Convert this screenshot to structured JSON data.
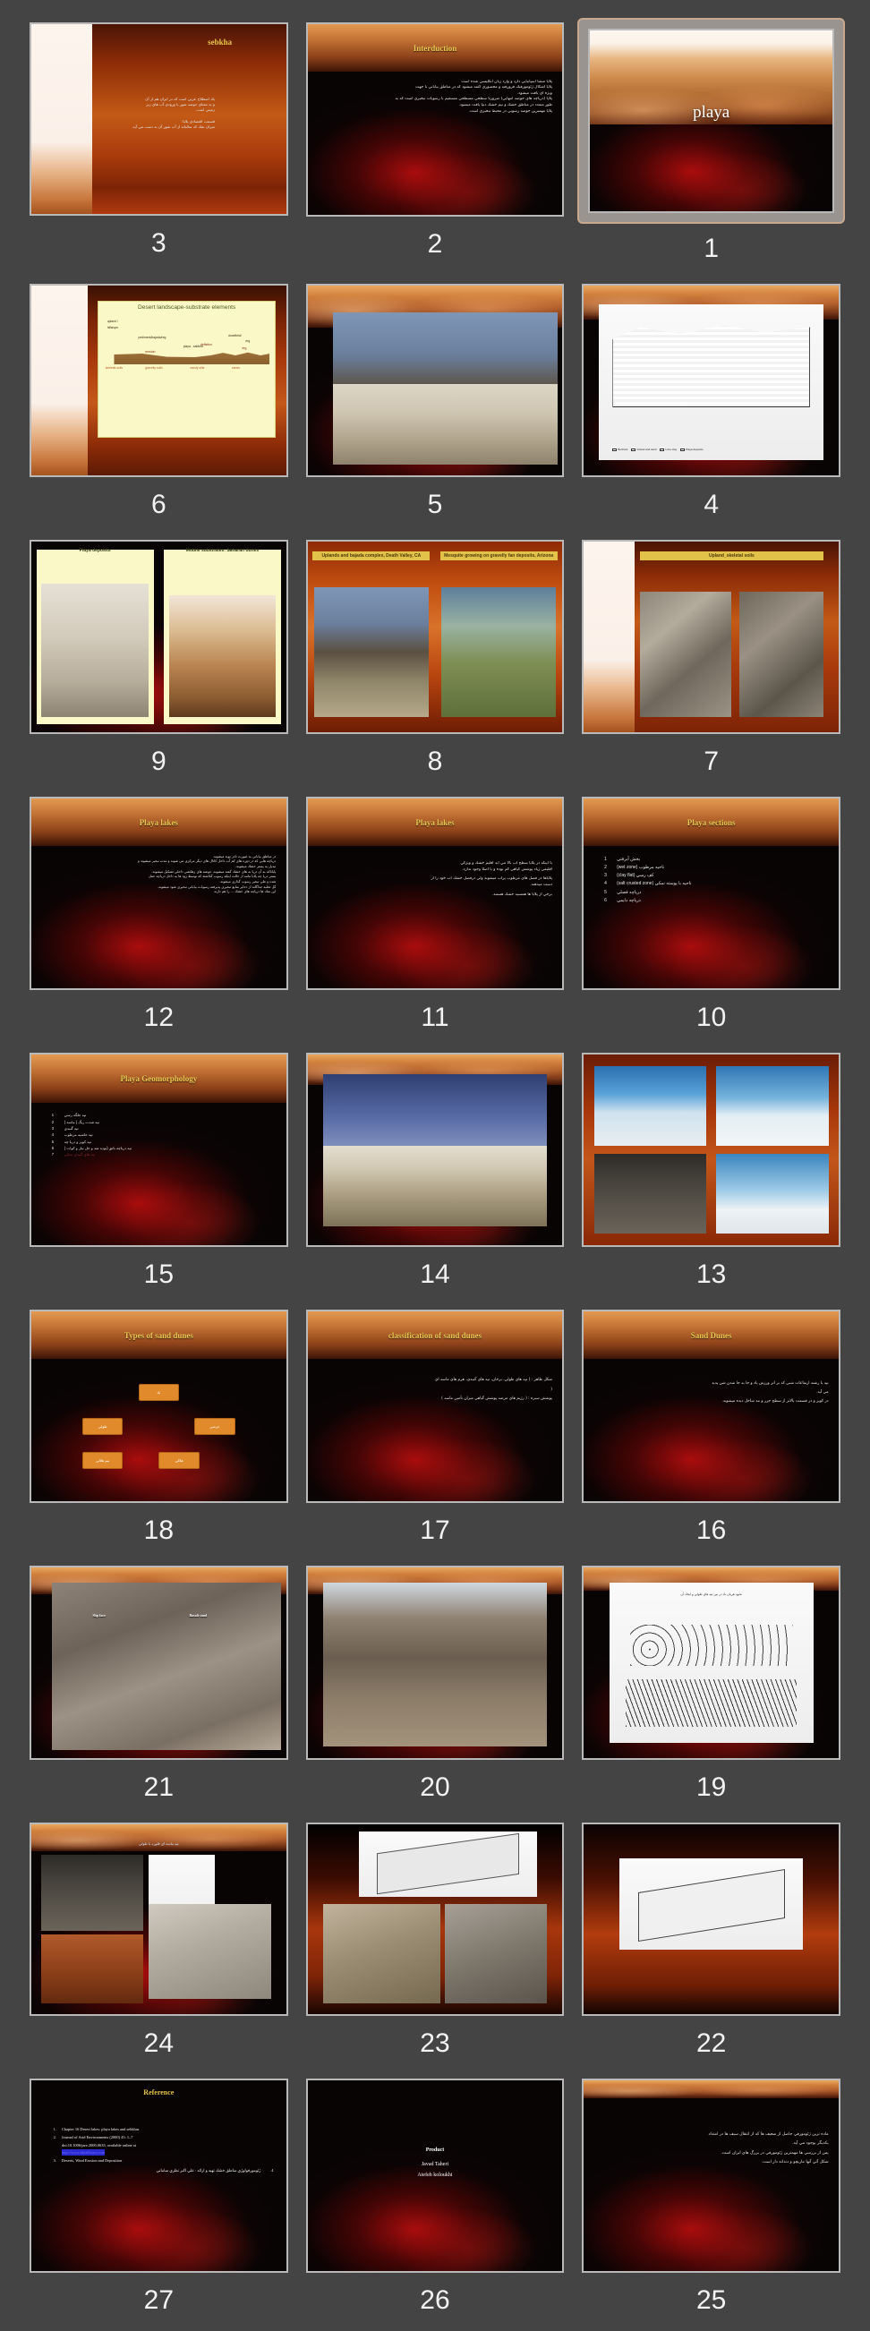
{
  "app": {
    "view": "slide-sorter",
    "background_color": "#444444",
    "selected_slide": 1,
    "total_slides": 27,
    "columns": 3,
    "reading_order": "right-to-left"
  },
  "slides": [
    {
      "number": "3",
      "layout": "sebkha",
      "title": "sebkha",
      "body": [
        "يك اصطلاح عربي است كه در ايران هم از آن",
        "و به معناي حوضه شور با ورودي آب هاي زير",
        "زميني است.",
        "قسمت اقتصادي پلايا:",
        "ميزان نمك كه ساليانه از آب شور آن به دست مي آيد."
      ]
    },
    {
      "number": "2",
      "layout": "title-body",
      "title": "Interduction",
      "body": [
        "پلايا منشأ اسپانيايي دارد و وارد زبان انگليسي شده است",
        "پلايا اشكال ژئومورفيك فرورفته و محصوري گفته ميشود كه در مناطق بياباني با جهت",
        "ويژه اي يافت ميشود.",
        "پلايا (درياچه هاي حوضه انتهايي) ضرورتاً سطحي مسطحي مستقيم با رسوبات تبخيري است كه به",
        "طور متعدد در مناطق خشك و نيم خشك دنيا يافت ميشود.",
        "پلايا مهمترين حوضه رسوبي در محيط تبخيري است."
      ]
    },
    {
      "number": "1",
      "layout": "cover",
      "title": "playa",
      "selected": true
    },
    {
      "number": "6",
      "layout": "diagram-box",
      "title": "Desert landscape-substrate elements",
      "labels": [
        "upland /",
        "hillslope",
        "pediment/bajada/reg",
        "dunefield/",
        "erg",
        "deflation",
        "erg",
        "erosion",
        "deposition",
        "alluvia",
        "playa - sabkha",
        "skeletal soils",
        "gravelly soils",
        "sandy silts",
        "sands"
      ]
    },
    {
      "number": "5",
      "layout": "photo-wide",
      "title": ""
    },
    {
      "number": "4",
      "layout": "line-diagram",
      "title": "",
      "legend": [
        "Bedrock",
        "Gravel and sand",
        "Lime clay",
        "Playa deposits"
      ]
    },
    {
      "number": "9",
      "layout": "two-photo",
      "panels": [
        {
          "caption": "Playa deposits"
        },
        {
          "caption": "Mobile substrates: Saharan dunes"
        }
      ]
    },
    {
      "number": "8",
      "layout": "two-photo",
      "panels": [
        {
          "caption": "Uplands and bajada complex, Death Valley, CA"
        },
        {
          "caption": "Mesquite growing on gravelly fan deposits, Arizona"
        }
      ]
    },
    {
      "number": "7",
      "layout": "titled-two-photo",
      "title": "Upland_skeletal soils"
    },
    {
      "number": "12",
      "layout": "title-body",
      "title": "Playa lakes",
      "body": [
        "در مناطق بياباني به صورت نادر توبه ميشوند.",
        "درياچه هايي كه در دوره هاي كم آب داخل كانال هاي ديگر مركزي مي شوند و مدت تبخير ميشوند و",
        "تبديل به پستر خشك ميشوند.",
        "پاياناكه به آن دريا به هاي خشك گفته ميشوند، حوضه هاي زهكشي داخلي تشكيل ميشوند.",
        "بستر دريا چه پلايا مانند از حالت اينكه رسوب گذاشته كه توسط رود ها به داخل درياچه حمل",
        "شده و طي تبخير رسوب گذاري ميشوند.",
        "گل تخليه جداگانه از ذخاير منابع تبخيري پذيرفته رسوبات بياباني تبخيري شود ميشوند.",
        "اين نمك ها درياچه هاي خشك ... را هم دارند"
      ]
    },
    {
      "number": "11",
      "layout": "title-body",
      "title": "Playa lakes",
      "body": [
        "با اينكه در پلايا سطح آب بالا مي آيد اقليم خشك و ويژگي",
        "اقليمي زياد پوشش گياهي كم بوده و يا اصلا وجود ندارد.",
        "پلاياها در فصل هاي مرطوب پرآب ميشوند ولي درفصل خشك آب خود را از",
        "دست ميدهند.",
        "برخي از پلايا ها همسيه خشك هستند."
      ]
    },
    {
      "number": "10",
      "layout": "numbered-list",
      "title": "Playa sections",
      "items": [
        {
          "n": "1",
          "t": "بخش آبرفتي"
        },
        {
          "n": "2",
          "t": "ناحيه مرطوب (wet zone)"
        },
        {
          "n": "3",
          "t": "كف رسي (clay flat)"
        },
        {
          "n": "4",
          "t": "ناحيه با پوسته نمكي (salt crusted zone)"
        },
        {
          "n": "5",
          "t": "درياچه فصلي"
        },
        {
          "n": "6",
          "t": "درياچه دايمي"
        }
      ]
    },
    {
      "number": "15",
      "layout": "numbered-list",
      "title": "Playa Geomorphology",
      "items": [
        {
          "n": "1",
          "t": "تپه جلگه رسي"
        },
        {
          "n": "2",
          "t": "تپه شدت ريگ ( ماسه )"
        },
        {
          "n": "3",
          "t": "تپه گنبدي"
        },
        {
          "n": "4",
          "t": "تپه حاشيه مرطوب"
        },
        {
          "n": "5",
          "t": "تپه كوير و دريا چه"
        },
        {
          "n": "6",
          "t": "تپه درياچه باتق (توده شد و حل نياز و كوات )"
        },
        {
          "n": "7",
          "t": "تپه هاي گنبدي نمكي"
        }
      ]
    },
    {
      "number": "14",
      "layout": "photo-wide",
      "title": ""
    },
    {
      "number": "13",
      "layout": "photo-collage",
      "title": ""
    },
    {
      "number": "18",
      "layout": "flow-diagram",
      "title": "Types of sand dunes",
      "nodes": [
        "باد",
        "طولي",
        "عرضي",
        "نيم هلالي",
        "هلالي"
      ]
    },
    {
      "number": "17",
      "layout": "title-body",
      "title": "classification of sand dunes",
      "body": [
        "شكل ظاهر : ( تپه هاي طولي، برخان، تپه هاي گنبدي، هرم هاي ماسه اي",
        "(",
        "پوشش سبزه : ( رژيم هاي مرضه پوشش گياهي ميزان تأمين ماسه )"
      ]
    },
    {
      "number": "16",
      "layout": "title-body",
      "title": "Sand Dunes",
      "body": [
        "تپه يا رشته ارتفاعات شني كه بر اثر ورزش باد و جا به جا شدن شن پديد",
        "مي آيد.",
        "در كوير و در قسمت بالاتر از سطح جزر و مد ساحل ديده ميشوند."
      ]
    },
    {
      "number": "21",
      "layout": "photo-annotated",
      "captions": [
        "Slip face",
        "Basalt sand"
      ]
    },
    {
      "number": "20",
      "layout": "photo-wide",
      "title": ""
    },
    {
      "number": "19",
      "layout": "diagram-white",
      "title": "نحوه هريان باد در بين تپه هاي طولي و ايجاد آن"
    },
    {
      "number": "24",
      "layout": "photo-collage",
      "title": "تپه ماسه اي فلوره يا طولي"
    },
    {
      "number": "23",
      "layout": "photo-collage",
      "title": ""
    },
    {
      "number": "22",
      "layout": "block-diagram",
      "title": ""
    },
    {
      "number": "25",
      "layout": "title-body-plain",
      "body": [
        "ماده ترين ژئومورفي حاصل از ضعيف ها كه از انتقال سيف ها در امتداد",
        "يكديگر بوجود مي آيد.",
        "پس از بررسي ها مهمترين ژئومورفي در بزرگ هاي ايران است.",
        "شكل آتي آنها ماريچو و دندانه دار است."
      ]
    },
    {
      "number": "26",
      "layout": "credits",
      "title": "Product",
      "names": [
        "Javad Taheri",
        "Atefeh koloukhi"
      ]
    },
    {
      "number": "27",
      "layout": "reference",
      "title": "Reference",
      "items": [
        {
          "idx": "1.",
          "text": "Chapter 16 Desert lakes: playa lakes and sebkhas"
        },
        {
          "idx": "2.",
          "text": "Journal of Arid Environments (2000) 45: 1–7"
        },
        {
          "idx": "",
          "text": "doi:10.1006/jare.2000.0633, available online at"
        },
        {
          "idx": "",
          "text": "http://www.idealibrary.com",
          "link": true
        },
        {
          "idx": "3.",
          "text": "Deserts, Wind Erosion and Deposition"
        },
        {
          "idx": "4.",
          "text": "ژئومورفولوژي مناطق خشك تهيه و ارائه : علي اكبر نظري ساماني",
          "rtl": true
        }
      ]
    }
  ]
}
